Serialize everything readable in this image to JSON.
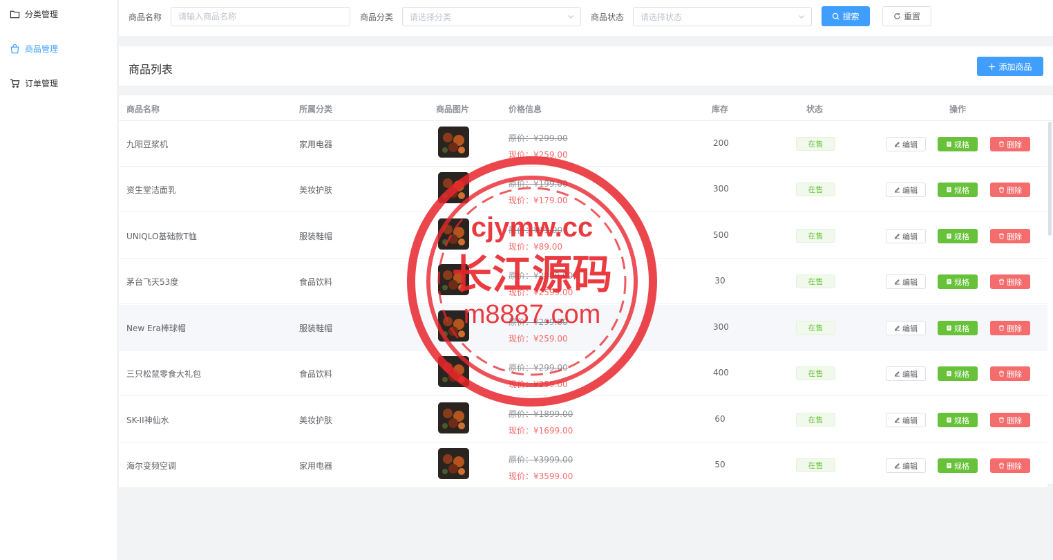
{
  "sidebar": {
    "items": [
      {
        "label": "分类管理",
        "icon": "folder-icon",
        "active": false
      },
      {
        "label": "商品管理",
        "icon": "shopping-bag-icon",
        "active": true
      },
      {
        "label": "订单管理",
        "icon": "cart-icon",
        "active": false
      }
    ]
  },
  "search": {
    "name_label": "商品名称",
    "name_placeholder": "请输入商品名称",
    "category_label": "商品分类",
    "category_placeholder": "请选择分类",
    "status_label": "商品状态",
    "status_placeholder": "请选择状态",
    "search_button": "搜索",
    "reset_button": "重置"
  },
  "list": {
    "title": "商品列表",
    "add_button": "添加商品"
  },
  "table": {
    "headers": {
      "name": "商品名称",
      "category": "所属分类",
      "image": "商品图片",
      "price": "价格信息",
      "stock": "库存",
      "status": "状态",
      "actions": "操作"
    },
    "rows": [
      {
        "name": "九阳豆浆机",
        "category": "家用电器",
        "orig": "原价：¥299.00",
        "now": "现价：¥259.00",
        "stock": "200",
        "status": "在售"
      },
      {
        "name": "资生堂洁面乳",
        "category": "美妆护肤",
        "orig": "原价：¥199.00",
        "now": "现价：¥179.00",
        "stock": "300",
        "status": "在售"
      },
      {
        "name": "UNIQLO基础款T恤",
        "category": "服装鞋帽",
        "orig": "原价：¥99.00",
        "now": "现价：¥89.00",
        "stock": "500",
        "status": "在售"
      },
      {
        "name": "茅台飞天53度",
        "category": "食品饮料",
        "orig": "原价：¥2999.00",
        "now": "现价：¥2599.00",
        "stock": "30",
        "status": "在售"
      },
      {
        "name": "New Era棒球帽",
        "category": "服装鞋帽",
        "orig": "原价：¥299.00",
        "now": "现价：¥259.00",
        "stock": "300",
        "status": "在售"
      },
      {
        "name": "三只松鼠零食大礼包",
        "category": "食品饮料",
        "orig": "原价：¥299.00",
        "now": "现价：¥259.00",
        "stock": "400",
        "status": "在售"
      },
      {
        "name": "SK-II神仙水",
        "category": "美妆护肤",
        "orig": "原价：¥1899.00",
        "now": "现价：¥1699.00",
        "stock": "60",
        "status": "在售"
      },
      {
        "name": "海尔变频空调",
        "category": "家用电器",
        "orig": "原价：¥3999.00",
        "now": "现价：¥3599.00",
        "stock": "50",
        "status": "在售"
      }
    ],
    "actions": {
      "edit": "编辑",
      "spec": "规格",
      "delete": "删除"
    }
  },
  "watermark": {
    "line1": "cjymw.cc",
    "line2": "长江源码",
    "line3": "m8887.com",
    "color": "#e8262d"
  },
  "colors": {
    "primary": "#409eff",
    "success": "#67c23a",
    "danger": "#f56c6c"
  }
}
